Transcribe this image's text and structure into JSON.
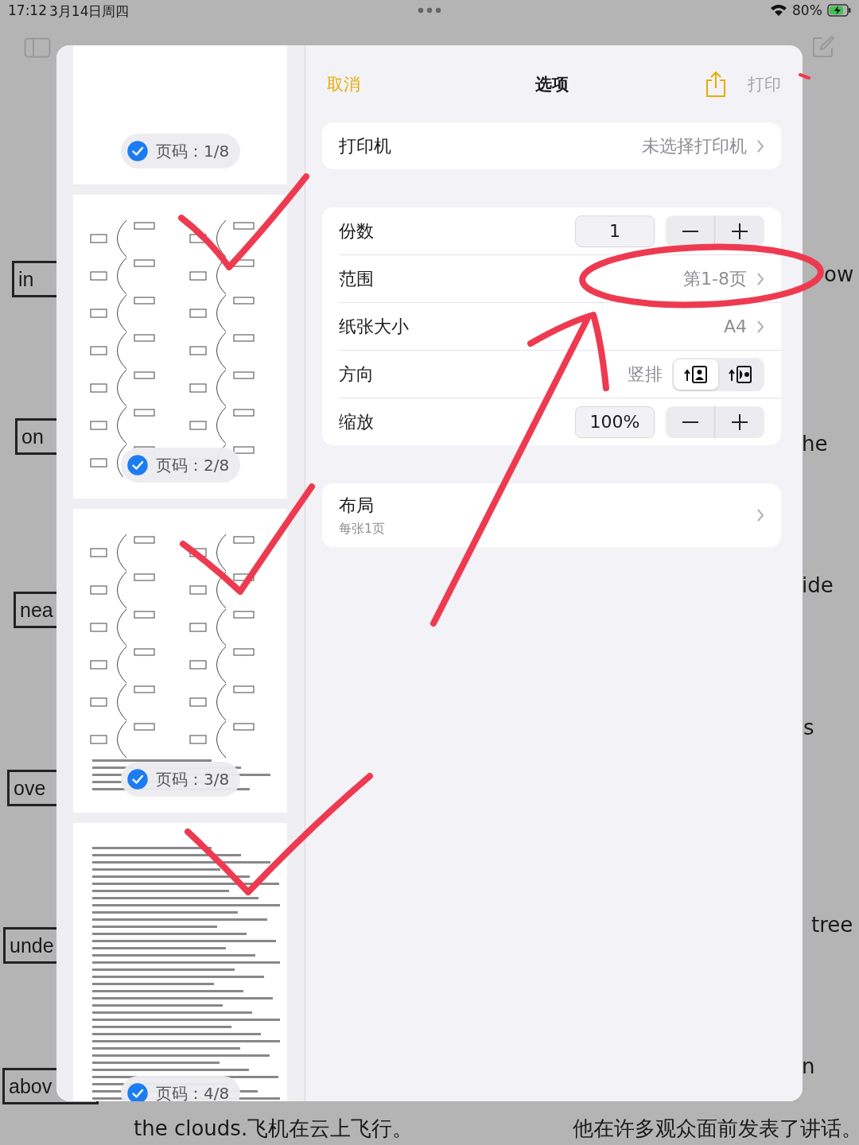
{
  "status_bar": {
    "time": "17:12",
    "date": "3月14日周四",
    "battery": "80%"
  },
  "background_doc": {
    "left_labels": [
      "in",
      "on",
      "nea",
      "ove",
      "unde",
      "abov"
    ],
    "right_fragments": [
      "ow",
      "he",
      "ide",
      "s",
      "tree",
      "n"
    ],
    "bottom_lines": [
      "the clouds.飞机在云上飞行。",
      "他在许多观众面前发表了讲话。"
    ]
  },
  "dialog": {
    "cancel": "取消",
    "title": "选项",
    "print": {
      "label": "打印",
      "disabled": true
    },
    "pages": [
      {
        "kind": "blank",
        "badge": "页码：1/8",
        "checked": true
      },
      {
        "kind": "diagram",
        "badge": "页码：2/8",
        "checked": true
      },
      {
        "kind": "mixed",
        "badge": "页码：3/8",
        "checked": true
      },
      {
        "kind": "text",
        "badge": "页码：4/8",
        "checked": true
      }
    ],
    "printer": {
      "label": "打印机",
      "value": "未选择打印机"
    },
    "settings": [
      {
        "kind": "stepper",
        "label": "份数",
        "value": "1"
      },
      {
        "kind": "link",
        "label": "范围",
        "value": "第1-8页"
      },
      {
        "kind": "link",
        "label": "纸张大小",
        "value": "A4"
      },
      {
        "kind": "orientation",
        "label": "方向",
        "value": "竖排",
        "options": [
          {
            "selected": true
          },
          {
            "selected": false
          }
        ]
      },
      {
        "kind": "stepper",
        "label": "缩放",
        "value": "100%"
      }
    ],
    "layout": {
      "label": "布局",
      "detail": "每张1页"
    }
  }
}
